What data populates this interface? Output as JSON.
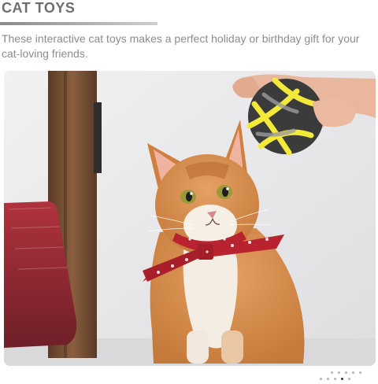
{
  "header": {
    "title": "CAT TOYS",
    "description": "These interactive cat toys makes a perfect holiday or birthday gift for your cat-loving friends."
  },
  "photo": {
    "subject": "orange-and-white-cat-with-red-snowflake-bandana-looking-at-yarn-ball",
    "palette": {
      "wall": "#e8e8ea",
      "cat_orange": "#d58a45",
      "cat_white": "#f4ede4",
      "bandana": "#b8232f",
      "ball_yellow": "#f2e93a",
      "ball_gray": "#3b3b3b",
      "post": "#7a5236",
      "cushion": "#9a2c35",
      "skin": "#e9b79e"
    }
  },
  "pager": {
    "total": 10,
    "active_index": 8
  }
}
